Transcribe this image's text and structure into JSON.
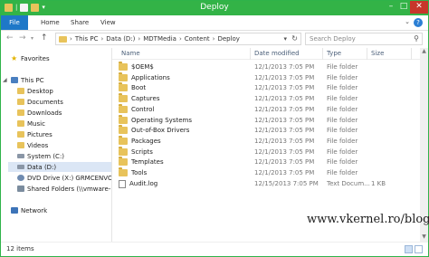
{
  "window": {
    "title": "Deploy"
  },
  "ribbon": {
    "tabs": [
      "File",
      "Home",
      "Share",
      "View"
    ]
  },
  "address": {
    "crumbs": [
      "This PC",
      "Data (D:)",
      "MDTMedia",
      "Content",
      "Deploy"
    ]
  },
  "search": {
    "placeholder": "Search Deploy"
  },
  "nav": {
    "favorites": "Favorites",
    "this_pc": "This PC",
    "items": [
      {
        "label": "Desktop",
        "icon": "folder-icon"
      },
      {
        "label": "Documents",
        "icon": "folder-icon"
      },
      {
        "label": "Downloads",
        "icon": "folder-icon"
      },
      {
        "label": "Music",
        "icon": "folder-icon"
      },
      {
        "label": "Pictures",
        "icon": "folder-icon"
      },
      {
        "label": "Videos",
        "icon": "folder-icon"
      },
      {
        "label": "System (C:)",
        "icon": "drive-icon"
      },
      {
        "label": "Data (D:)",
        "icon": "drive-icon"
      },
      {
        "label": "DVD Drive (X:) GRMCENVOL",
        "icon": "dvd-icon"
      },
      {
        "label": "Shared Folders (\\\\vmware-h",
        "icon": "share-icon"
      }
    ],
    "network": "Network"
  },
  "columns": {
    "name": "Name",
    "date": "Date modified",
    "type": "Type",
    "size": "Size"
  },
  "files": [
    {
      "name": "$OEM$",
      "date": "12/1/2013 7:05 PM",
      "type": "File folder",
      "size": "",
      "kind": "folder"
    },
    {
      "name": "Applications",
      "date": "12/1/2013 7:05 PM",
      "type": "File folder",
      "size": "",
      "kind": "folder"
    },
    {
      "name": "Boot",
      "date": "12/1/2013 7:05 PM",
      "type": "File folder",
      "size": "",
      "kind": "folder"
    },
    {
      "name": "Captures",
      "date": "12/1/2013 7:05 PM",
      "type": "File folder",
      "size": "",
      "kind": "folder"
    },
    {
      "name": "Control",
      "date": "12/1/2013 7:05 PM",
      "type": "File folder",
      "size": "",
      "kind": "folder"
    },
    {
      "name": "Operating Systems",
      "date": "12/1/2013 7:05 PM",
      "type": "File folder",
      "size": "",
      "kind": "folder"
    },
    {
      "name": "Out-of-Box Drivers",
      "date": "12/1/2013 7:05 PM",
      "type": "File folder",
      "size": "",
      "kind": "folder"
    },
    {
      "name": "Packages",
      "date": "12/1/2013 7:05 PM",
      "type": "File folder",
      "size": "",
      "kind": "folder"
    },
    {
      "name": "Scripts",
      "date": "12/1/2013 7:05 PM",
      "type": "File folder",
      "size": "",
      "kind": "folder"
    },
    {
      "name": "Templates",
      "date": "12/1/2013 7:05 PM",
      "type": "File folder",
      "size": "",
      "kind": "folder"
    },
    {
      "name": "Tools",
      "date": "12/1/2013 7:05 PM",
      "type": "File folder",
      "size": "",
      "kind": "folder"
    },
    {
      "name": "Audit.log",
      "date": "12/15/2013 7:05 PM",
      "type": "Text Docum...",
      "size": "1 KB",
      "kind": "file"
    }
  ],
  "status": {
    "count": "12 items"
  },
  "watermark": "www.vkernel.ro/blog",
  "colors": {
    "titlebar": "#33b347",
    "file_tab": "#1e78c8",
    "folder": "#e8c35b",
    "close": "#c7362b"
  }
}
